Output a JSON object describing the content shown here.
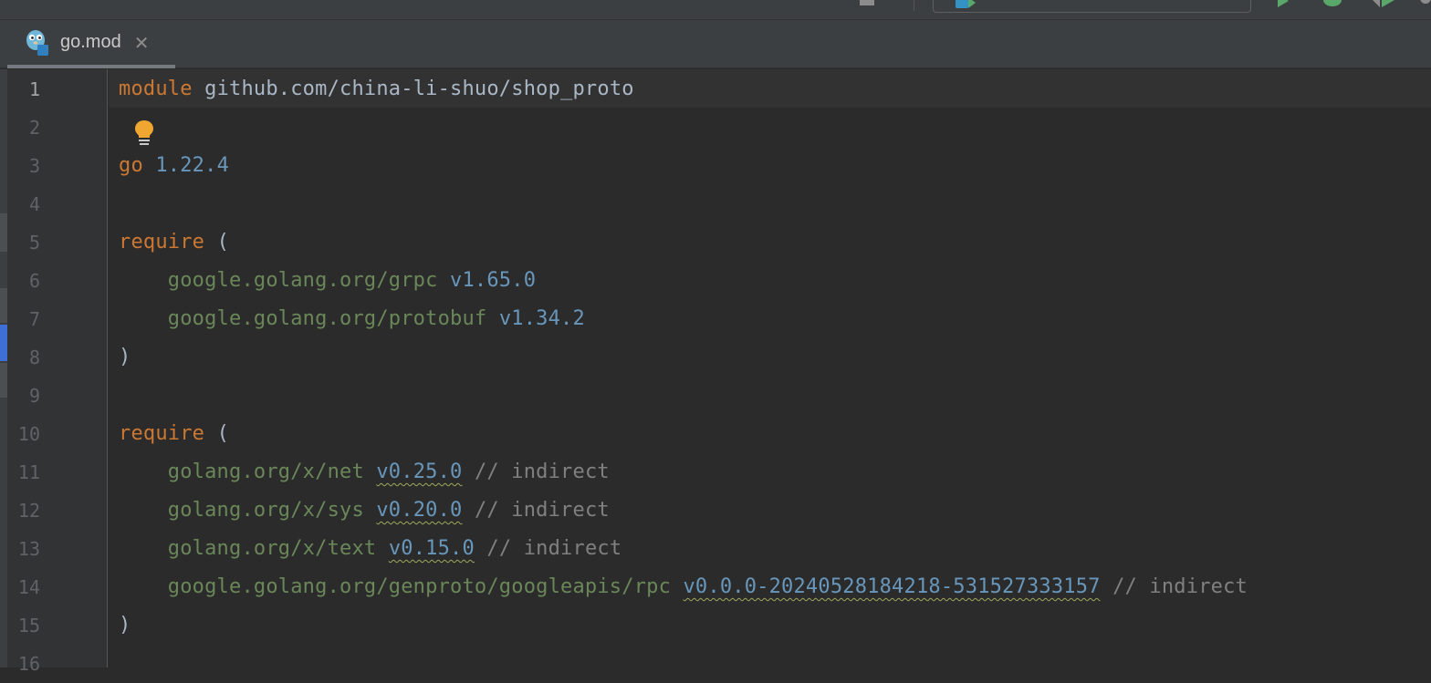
{
  "file_tab": {
    "title": "go.mod",
    "close_glyph": "✕",
    "icon": "gopher-icon"
  },
  "colors": {
    "keyword": "#cc7832",
    "string_path": "#6a8759",
    "version": "#6897bb",
    "comment": "#808080",
    "text": "#a9b7c6",
    "background": "#2b2b2b"
  },
  "editor": {
    "current_line": 1,
    "intention_icon": "lightbulb-icon",
    "line_numbers": [
      "1",
      "2",
      "3",
      "4",
      "5",
      "6",
      "7",
      "8",
      "9",
      "10",
      "11",
      "12",
      "13",
      "14",
      "15",
      "16"
    ],
    "lines": {
      "l1": {
        "keyword": "module",
        "module_path": "github.com/china-li-shuo/shop_proto"
      },
      "l3": {
        "keyword": "go",
        "version": "1.22.4"
      },
      "l5": {
        "keyword": "require",
        "paren": "("
      },
      "l6": {
        "path": "google.golang.org/grpc",
        "version": "v1.65.0"
      },
      "l7": {
        "path": "google.golang.org/protobuf",
        "version": "v1.34.2"
      },
      "l8": {
        "paren": ")"
      },
      "l10": {
        "keyword": "require",
        "paren": "("
      },
      "l11": {
        "path": "golang.org/x/net",
        "version": "v0.25.0",
        "comment": "// indirect"
      },
      "l12": {
        "path": "golang.org/x/sys",
        "version": "v0.20.0",
        "comment": "// indirect"
      },
      "l13": {
        "path": "golang.org/x/text",
        "version": "v0.15.0",
        "comment": "// indirect"
      },
      "l14": {
        "path": "google.golang.org/genproto/googleapis/rpc",
        "version": "v0.0.0-20240528184218-531527333157",
        "comment": "// indirect"
      },
      "l15": {
        "paren": ")"
      }
    }
  }
}
